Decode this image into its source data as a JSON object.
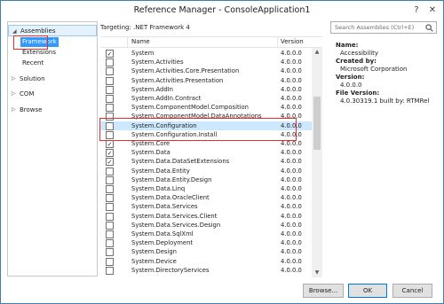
{
  "window": {
    "title": "Reference Manager - ConsoleApplication1"
  },
  "titlebar": {
    "help_label": "?",
    "close_label": "✕"
  },
  "sidebar": {
    "assemblies": {
      "label": "Assemblies",
      "arrow": "◢"
    },
    "sub_items": [
      {
        "label": "Framework",
        "selected": true
      },
      {
        "label": "Extensions",
        "selected": false
      },
      {
        "label": "Recent",
        "selected": false
      }
    ],
    "groups": [
      {
        "label": "Solution",
        "arrow": "▷"
      },
      {
        "label": "COM",
        "arrow": "▷"
      },
      {
        "label": "Browse",
        "arrow": "▷"
      }
    ]
  },
  "targeting": "Targeting: .NET Framework 4",
  "search": {
    "placeholder": "Search Assemblies (Ctrl+E)"
  },
  "list": {
    "columns": {
      "name": "Name",
      "version": "Version"
    },
    "rows": [
      {
        "name": "System",
        "version": "4.0.0.0",
        "checked": true
      },
      {
        "name": "System.Activities",
        "version": "4.0.0.0",
        "checked": false
      },
      {
        "name": "System.Activities.Core.Presentation",
        "version": "4.0.0.0",
        "checked": false
      },
      {
        "name": "System.Activities.Presentation",
        "version": "4.0.0.0",
        "checked": false
      },
      {
        "name": "System.AddIn",
        "version": "4.0.0.0",
        "checked": false
      },
      {
        "name": "System.AddIn.Contract",
        "version": "4.0.0.0",
        "checked": false
      },
      {
        "name": "System.ComponentModel.Composition",
        "version": "4.0.0.0",
        "checked": false
      },
      {
        "name": "System.ComponentModel.DataAnnotations",
        "version": "4.0.0.0",
        "checked": false
      },
      {
        "name": "System.Configuration",
        "version": "4.0.0.0",
        "checked": false,
        "highlighted": true
      },
      {
        "name": "System.Configuration.Install",
        "version": "4.0.0.0",
        "checked": false
      },
      {
        "name": "System.Core",
        "version": "4.0.0.0",
        "checked": true
      },
      {
        "name": "System.Data",
        "version": "4.0.0.0",
        "checked": true
      },
      {
        "name": "System.Data.DataSetExtensions",
        "version": "4.0.0.0",
        "checked": true
      },
      {
        "name": "System.Data.Entity",
        "version": "4.0.0.0",
        "checked": false
      },
      {
        "name": "System.Data.Entity.Design",
        "version": "4.0.0.0",
        "checked": false
      },
      {
        "name": "System.Data.Linq",
        "version": "4.0.0.0",
        "checked": false
      },
      {
        "name": "System.Data.OracleClient",
        "version": "4.0.0.0",
        "checked": false
      },
      {
        "name": "System.Data.Services",
        "version": "4.0.0.0",
        "checked": false
      },
      {
        "name": "System.Data.Services.Client",
        "version": "4.0.0.0",
        "checked": false
      },
      {
        "name": "System.Data.Services.Design",
        "version": "4.0.0.0",
        "checked": false
      },
      {
        "name": "System.Data.SqlXml",
        "version": "4.0.0.0",
        "checked": false
      },
      {
        "name": "System.Deployment",
        "version": "4.0.0.0",
        "checked": false
      },
      {
        "name": "System.Design",
        "version": "4.0.0.0",
        "checked": false
      },
      {
        "name": "System.Device",
        "version": "4.0.0.0",
        "checked": false
      },
      {
        "name": "System.DirectoryServices",
        "version": "4.0.0.0",
        "checked": false
      }
    ]
  },
  "details": {
    "name_label": "Name:",
    "name_value": "Accessibility",
    "created_label": "Created by:",
    "created_value": "Microsoft Corporation",
    "version_label": "Version:",
    "version_value": "4.0.0.0",
    "file_version_label": "File Version:",
    "file_version_value": "4.0.30319.1 built by: RTMRel"
  },
  "buttons": {
    "browse": "Browse...",
    "ok": "OK",
    "cancel": "Cancel"
  },
  "colors": {
    "selection": "#3399ff",
    "highlight_row": "#cce8ff",
    "annotation_red": "#e03131",
    "window_border": "#3c7fb1"
  }
}
